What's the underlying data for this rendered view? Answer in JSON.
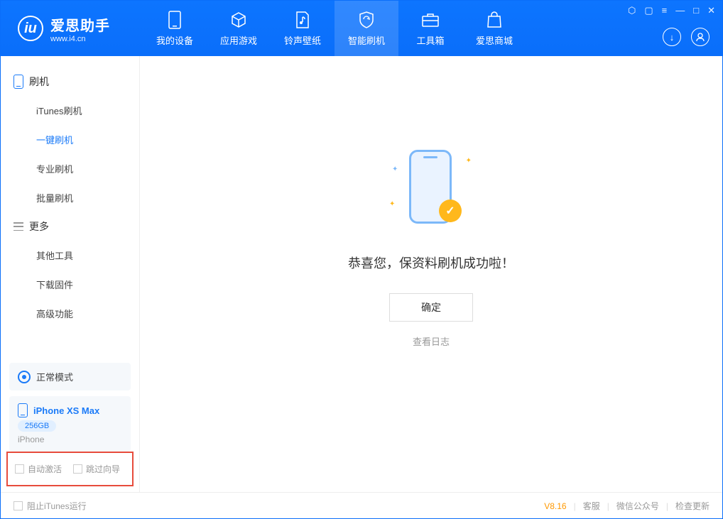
{
  "app": {
    "title": "爱思助手",
    "subtitle": "www.i4.cn"
  },
  "tabs": [
    {
      "label": "我的设备"
    },
    {
      "label": "应用游戏"
    },
    {
      "label": "铃声壁纸"
    },
    {
      "label": "智能刷机"
    },
    {
      "label": "工具箱"
    },
    {
      "label": "爱思商城"
    }
  ],
  "sidebar": {
    "section1_title": "刷机",
    "items1": [
      "iTunes刷机",
      "一键刷机",
      "专业刷机",
      "批量刷机"
    ],
    "section2_title": "更多",
    "items2": [
      "其他工具",
      "下载固件",
      "高级功能"
    ]
  },
  "mode": {
    "label": "正常模式"
  },
  "device": {
    "name": "iPhone XS Max",
    "storage": "256GB",
    "type": "iPhone"
  },
  "options": {
    "auto_activate": "自动激活",
    "skip_guide": "跳过向导"
  },
  "main": {
    "success_msg": "恭喜您，保资料刷机成功啦！",
    "ok_label": "确定",
    "log_link": "查看日志"
  },
  "footer": {
    "block_itunes": "阻止iTunes运行",
    "version": "V8.16",
    "links": [
      "客服",
      "微信公众号",
      "检查更新"
    ]
  }
}
